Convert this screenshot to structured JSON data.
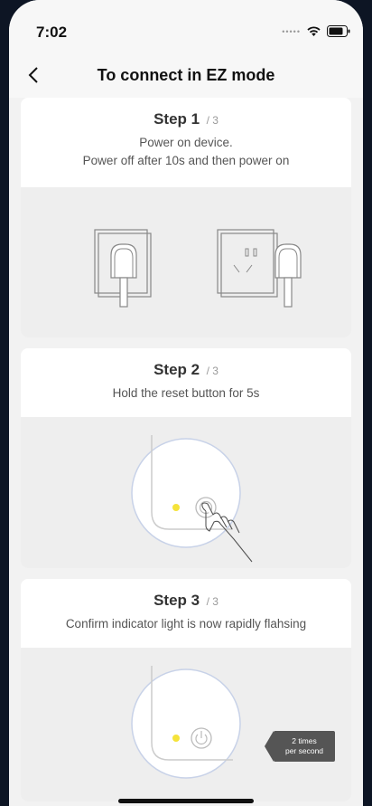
{
  "status": {
    "time": "7:02"
  },
  "nav": {
    "title": "To connect in EZ mode"
  },
  "steps": [
    {
      "label": "Step 1",
      "of": "/ 3",
      "desc1": "Power on device.",
      "desc2": "Power off after 10s and then power on"
    },
    {
      "label": "Step 2",
      "of": "/ 3",
      "desc1": "Hold the reset button for 5s"
    },
    {
      "label": "Step 3",
      "of": "/ 3",
      "desc1": "Confirm indicator light is now rapidly flahsing",
      "tip": "2 times",
      "tip2": "per second"
    }
  ],
  "colors": {
    "indicator": "#f5e33a",
    "accent": "#111111"
  }
}
